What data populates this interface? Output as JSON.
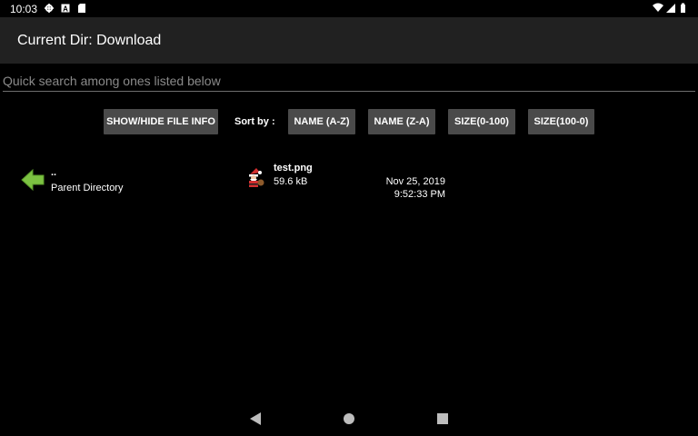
{
  "status": {
    "time": "10:03",
    "left_icons": [
      "gear-icon",
      "a-box-icon",
      "sd-card-icon"
    ],
    "right_icons": [
      "wifi-icon",
      "signal-icon",
      "battery-icon"
    ]
  },
  "header": {
    "title": "Current Dir: Download"
  },
  "search": {
    "placeholder": "Quick search among ones listed below",
    "value": ""
  },
  "controls": {
    "show_hide_label": "SHOW/HIDE FILE INFO",
    "sort_label": "Sort by :",
    "name_az": "NAME (A-Z)",
    "name_za": "NAME (Z-A)",
    "size_asc": "SIZE(0-100)",
    "size_desc": "SIZE(100-0)"
  },
  "entries": {
    "parent": {
      "name": "..",
      "sub": "Parent Directory",
      "icon": "back-arrow-icon",
      "icon_color": "#7cc242"
    },
    "file": {
      "name": "test.png",
      "size": "59.6 kB",
      "date": "Nov 25, 2019",
      "time": "9:52:33 PM",
      "icon": "santa-icon"
    }
  },
  "nav": {
    "icons": [
      "back-icon",
      "home-icon",
      "recents-icon"
    ]
  },
  "colors": {
    "background": "#000000",
    "toolbar": "#212121",
    "button": "#4a4a4a",
    "accent_arrow": "#7cc242"
  }
}
